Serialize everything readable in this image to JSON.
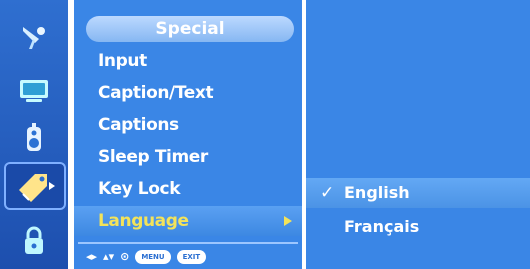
{
  "menu": {
    "title": "Special",
    "items": [
      {
        "label": "Input"
      },
      {
        "label": "Caption/Text"
      },
      {
        "label": "Captions"
      },
      {
        "label": "Sleep Timer"
      },
      {
        "label": "Key Lock"
      },
      {
        "label": "Language"
      }
    ],
    "selected": "Language"
  },
  "language_submenu": {
    "options": [
      {
        "label": "English",
        "selected": true
      },
      {
        "label": "Français",
        "selected": false
      }
    ],
    "checked_symbol": "✓"
  },
  "footer": {
    "nav_left_right": "◂▸",
    "nav_up_down": "▴▾",
    "ok_symbol": "⊙",
    "menu_key": "MENU",
    "exit_key": "EXIT"
  },
  "icons": [
    {
      "name": "antenna-icon"
    },
    {
      "name": "screen-icon"
    },
    {
      "name": "audio-icon"
    },
    {
      "name": "special-tag-icon",
      "active": true
    },
    {
      "name": "lock-icon"
    }
  ],
  "colors": {
    "menu_blue": "#3a86e6",
    "highlight_text": "#f3e35a",
    "text": "#ffffff"
  }
}
